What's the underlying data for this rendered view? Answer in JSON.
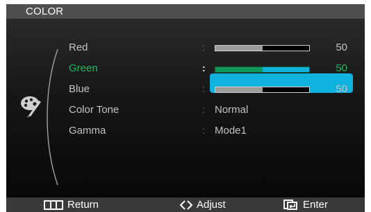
{
  "menu": {
    "title": "COLOR"
  },
  "items": [
    {
      "label": "Red",
      "type": "slider",
      "value": 50,
      "display": "50",
      "selected": false
    },
    {
      "label": "Green",
      "type": "slider",
      "value": 50,
      "display": "50",
      "selected": true
    },
    {
      "label": "Blue",
      "type": "slider",
      "value": 50,
      "display": "50",
      "selected": false
    },
    {
      "label": "Color Tone",
      "type": "option",
      "value_text": "Normal",
      "selected": false
    },
    {
      "label": "Gamma",
      "type": "option",
      "value_text": "Mode1",
      "selected": false
    }
  ],
  "separator": ":",
  "footer": {
    "return": "Return",
    "adjust": "Adjust",
    "enter": "Enter"
  },
  "icons": [
    "palette-icon",
    "return-icon",
    "adjust-icon",
    "enter-icon"
  ],
  "colors": {
    "highlight": "#0fb2dc",
    "selected_text": "#1fb85e",
    "slider_fill": "#9c9c9c",
    "selected_fill": "#10995a"
  }
}
